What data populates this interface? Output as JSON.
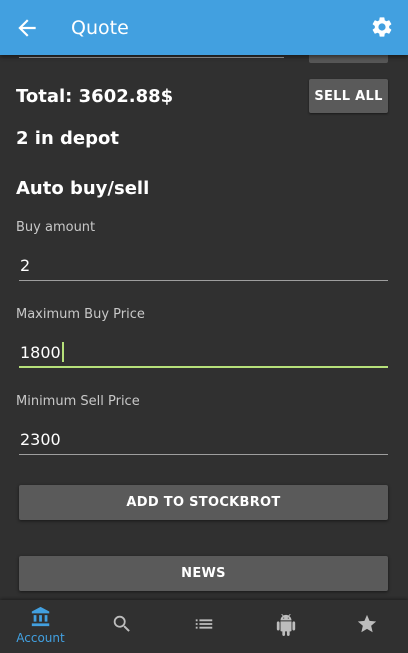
{
  "app_bar": {
    "title": "Quote",
    "back_icon": "arrow-back-icon",
    "settings_icon": "gear-icon",
    "color": "#42a0e0"
  },
  "summary": {
    "total": "Total: 3602.88$",
    "sell_all_label": "SELL ALL",
    "depot": "2 in depot"
  },
  "auto": {
    "title": "Auto buy/sell",
    "buy_amount": {
      "label": "Buy amount",
      "value": "2"
    },
    "max_buy_price": {
      "label": "Maximum Buy Price",
      "value": "1800"
    },
    "min_sell_price": {
      "label": "Minimum Sell Price",
      "value": "2300"
    }
  },
  "actions": {
    "add_label": "ADD TO STOCKBROT",
    "news_label": "NEWS"
  },
  "bottom_nav": {
    "accent": "#42a0e0",
    "items": [
      {
        "icon": "bank-icon",
        "label": "Account",
        "active": true
      },
      {
        "icon": "search-icon"
      },
      {
        "icon": "list-icon"
      },
      {
        "icon": "android-icon"
      },
      {
        "icon": "star-icon"
      }
    ]
  }
}
